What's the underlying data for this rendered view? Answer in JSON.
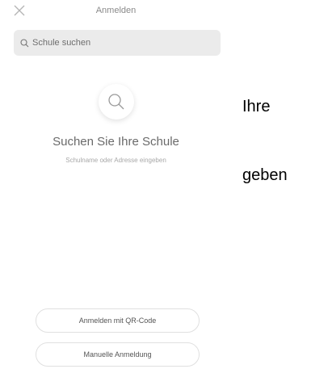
{
  "nav": {
    "title": "Anmelden"
  },
  "search": {
    "placeholder": "Schule suchen"
  },
  "empty_state": {
    "title": "Suchen Sie Ihre Schule",
    "subtitle": "Schulname oder Adresse eingeben"
  },
  "buttons": {
    "qr_login": "Anmelden mit QR-Code",
    "manual_login": "Manuelle Anmeldung"
  },
  "side_text": {
    "line1": "Ihre",
    "line2": "geben"
  },
  "colors": {
    "search_bg": "#ebebeb",
    "muted_text": "#8a8a8a"
  },
  "icons": {
    "close": "close-icon",
    "search": "search-icon"
  }
}
